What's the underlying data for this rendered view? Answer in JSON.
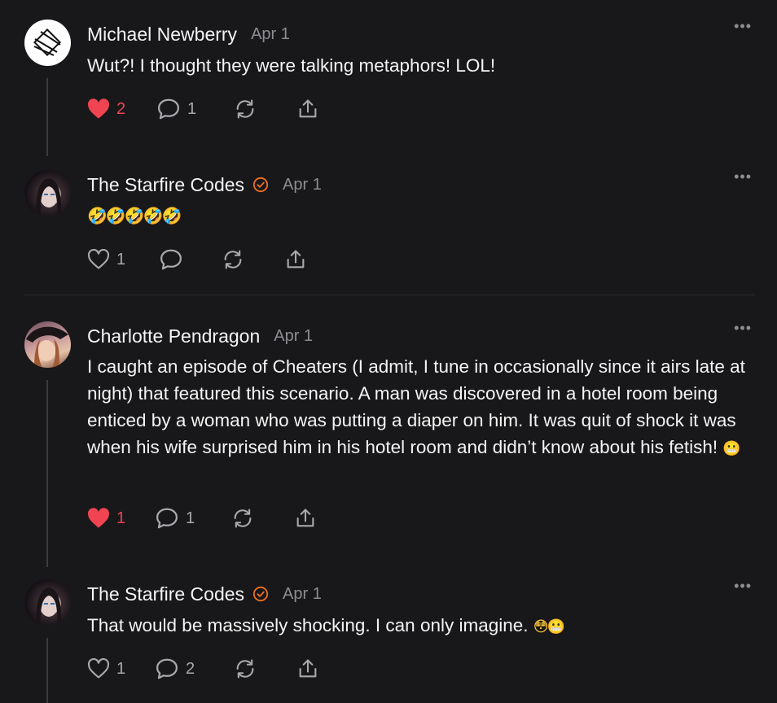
{
  "posts": [
    {
      "author": "Michael Newberry",
      "date": "Apr 1",
      "text": "Wut?! I thought they were talking metaphors! LOL!",
      "avatar": "abstract-logo",
      "verified": false,
      "likes": "2",
      "liked": true,
      "comments": "1"
    },
    {
      "author": "The Starfire Codes",
      "date": "Apr 1",
      "text": "🤣🤣🤣🤣🤣",
      "avatar": "photo",
      "verified": true,
      "likes": "1",
      "liked": false,
      "comments": ""
    },
    {
      "author": "Charlotte Pendragon",
      "date": "Apr 1",
      "text": "I caught an episode of Cheaters (I admit, I tune in occasionally since it airs late at night) that featured this scenario. A man was discovered in a hotel room being enticed by a woman who was putting a diaper on him. It was quit of shock it was when his wife surprised him in his hotel room and didn’t know about his fetish!",
      "text_emoji": "😬",
      "avatar": "photo",
      "verified": false,
      "likes": "1",
      "liked": true,
      "comments": "1"
    },
    {
      "author": "The Starfire Codes",
      "date": "Apr 1",
      "text": "That would be massively shocking. I can only imagine.",
      "text_emoji": "😳😬",
      "avatar": "photo",
      "verified": true,
      "likes": "1",
      "liked": false,
      "comments": "2"
    }
  ],
  "more_label": "•••",
  "colors": {
    "background": "#18181a",
    "liked": "#f04452",
    "verified": "#f36f21",
    "muted": "#8d8d92"
  },
  "icons": [
    "heart-icon",
    "comment-icon",
    "repost-icon",
    "share-icon",
    "more-icon",
    "verified-icon"
  ]
}
